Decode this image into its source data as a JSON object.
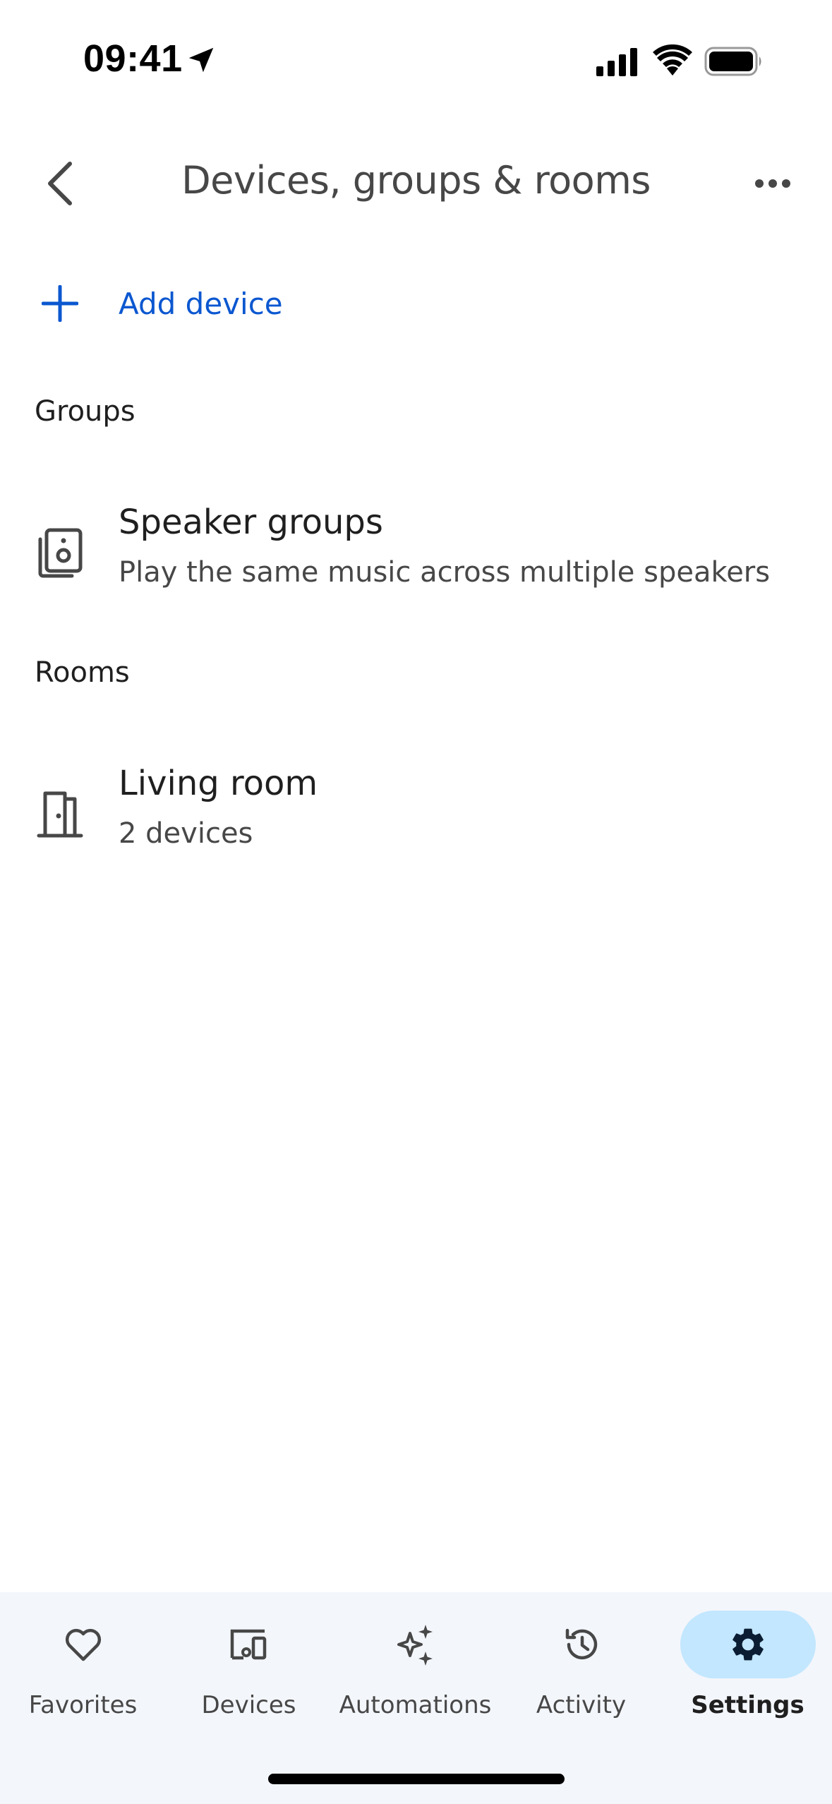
{
  "status_bar": {
    "time": "09:41"
  },
  "header": {
    "title": "Devices, groups & rooms",
    "back_icon": "chevron-left-icon",
    "more_icon": "more-horiz-icon"
  },
  "add_device": {
    "label": "Add device",
    "icon": "plus-icon"
  },
  "groups": {
    "header": "Groups",
    "items": [
      {
        "title": "Speaker groups",
        "subtitle": "Play the same music across multiple speakers",
        "icon": "speaker-group-icon"
      }
    ]
  },
  "rooms": {
    "header": "Rooms",
    "items": [
      {
        "title": "Living room",
        "subtitle": "2 devices",
        "icon": "door-icon"
      }
    ]
  },
  "bottom_nav": {
    "items": [
      {
        "label": "Favorites",
        "icon": "heart-icon",
        "active": false
      },
      {
        "label": "Devices",
        "icon": "devices-icon",
        "active": false
      },
      {
        "label": "Automations",
        "icon": "sparkle-icon",
        "active": false
      },
      {
        "label": "Activity",
        "icon": "history-icon",
        "active": false
      },
      {
        "label": "Settings",
        "icon": "gear-icon",
        "active": true
      }
    ]
  },
  "colors": {
    "accent": "#0b57d0",
    "active_pill": "#c2e7ff",
    "nav_background": "#f3f6fb",
    "text_primary": "#1f1f1f",
    "text_secondary": "#474747"
  }
}
